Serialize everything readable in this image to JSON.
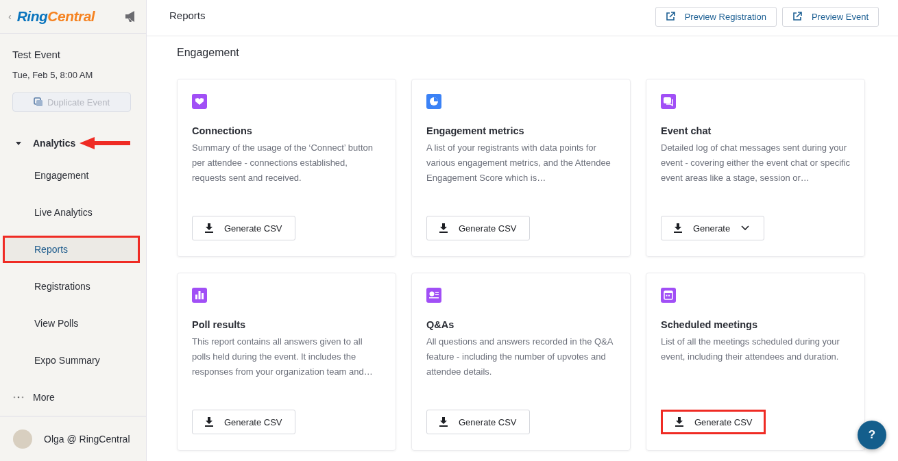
{
  "sidebar": {
    "back": "‹",
    "logo": {
      "part_1": "Ring",
      "part_2": "Central"
    },
    "event": {
      "title": "Test Event",
      "date": "Tue, Feb 5, 8:00 AM",
      "duplicate_button": {
        "label": "Duplicate Event",
        "disabled": true
      }
    },
    "section": {
      "label": "Analytics",
      "expanded": true,
      "arrow_annotation": true,
      "children": [
        {
          "label": "Engagement",
          "selected": false,
          "highlighted": false
        },
        {
          "label": "Live Analytics",
          "selected": false,
          "highlighted": false
        },
        {
          "label": "Reports",
          "selected": true,
          "highlighted": true
        },
        {
          "label": "Registrations",
          "selected": false,
          "highlighted": false
        },
        {
          "label": "View Polls",
          "selected": false,
          "highlighted": false
        },
        {
          "label": "Expo Summary",
          "selected": false,
          "highlighted": false
        }
      ]
    },
    "more": "More",
    "user": "Olga @ RingCentral"
  },
  "header": {
    "title": "Reports",
    "buttons": [
      "Preview Registration",
      "Preview Event"
    ]
  },
  "section_title": "Engagement",
  "cards": [
    {
      "color": "#a14ff6",
      "title": "Connections",
      "description": "Summary of the usage of the ‘Connect’ button per attendee - connections established, requests sent and received.",
      "button": {
        "kind": "csv",
        "label": "Generate CSV",
        "highlighted": false
      }
    },
    {
      "color": "#3b82f6",
      "title": "Engagement metrics",
      "description": "A list of your registrants with data points for various engagement metrics, and the Attendee Engagement Score which is…",
      "button": {
        "kind": "csv",
        "label": "Generate CSV",
        "highlighted": false
      }
    },
    {
      "color": "#a14ff6",
      "title": "Event chat",
      "description": "Detailed log of chat messages sent during your event - covering either the event chat or specific event areas like a stage, session or…",
      "button": {
        "kind": "dropdown",
        "label": "Generate",
        "highlighted": false
      }
    },
    {
      "color": "#a14ff6",
      "title": "Poll results",
      "description": "This report contains all answers given to all polls held during the event. It includes the responses from your organization team and…",
      "button": {
        "kind": "csv",
        "label": "Generate CSV",
        "highlighted": false
      }
    },
    {
      "color": "#a14ff6",
      "title": "Q&As",
      "description": "All questions and answers recorded in the Q&A feature - including the number of upvotes and attendee details.",
      "button": {
        "kind": "csv",
        "label": "Generate CSV",
        "highlighted": false
      }
    },
    {
      "color": "#a14ff6",
      "title": "Scheduled meetings",
      "description": "List of all the meetings scheduled during your event, including their attendees and duration.",
      "button": {
        "kind": "csv",
        "label": "Generate CSV",
        "highlighted": true
      }
    }
  ],
  "help_button": "?"
}
